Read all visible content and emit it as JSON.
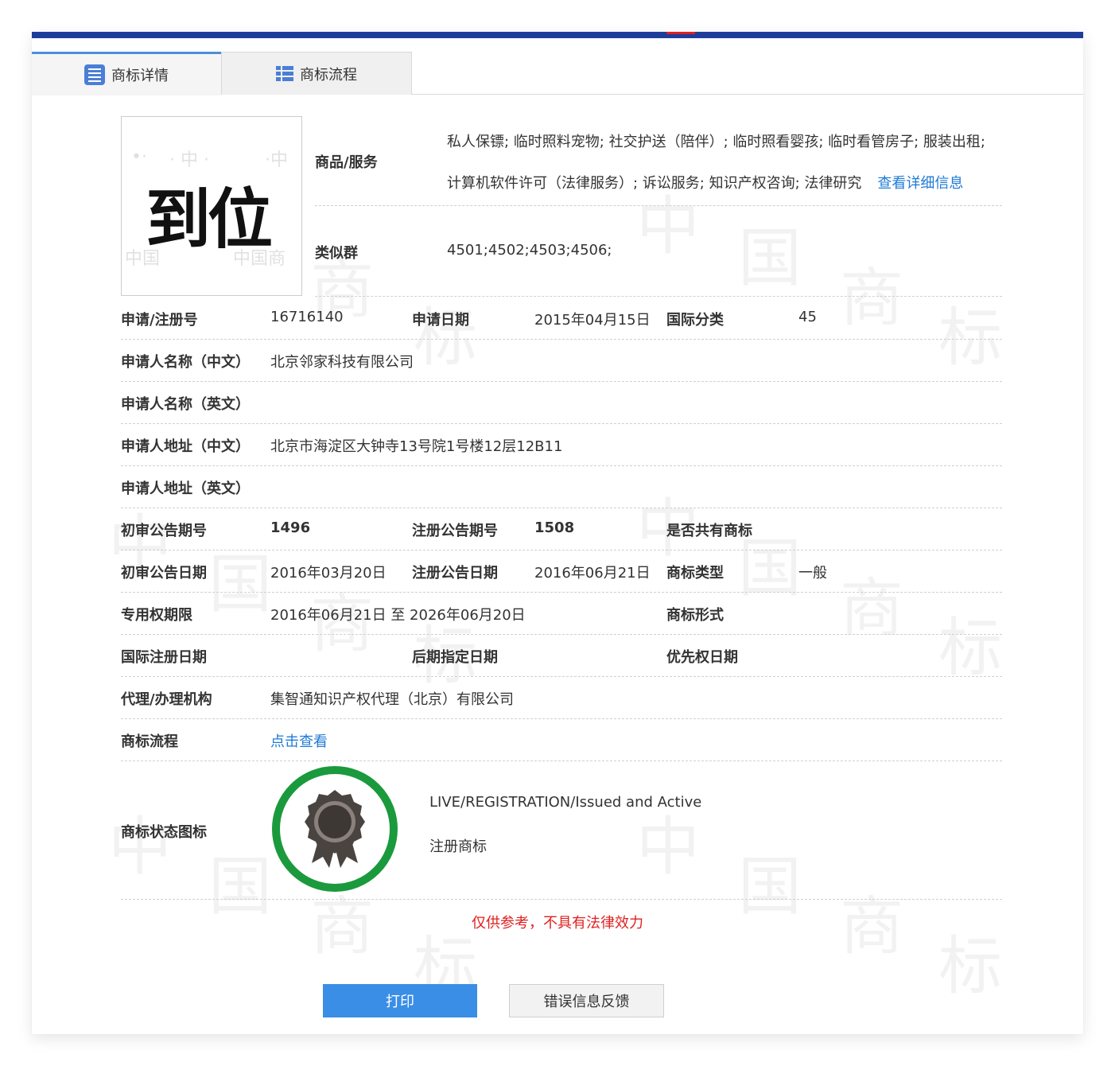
{
  "tabs": {
    "detail": "商标详情",
    "process": "商标流程"
  },
  "trademark": {
    "mark_text": "到位",
    "goods_label": "商品/服务",
    "goods_line1": "私人保镖; 临时照料宠物; 社交护送（陪伴）; 临时照看婴孩; 临时看管房子; 服装出租;",
    "goods_line2": "计算机软件许可（法律服务）; 诉讼服务; 知识产权咨询; 法律研究",
    "goods_more_link": "查看详细信息",
    "similar_label": "类似群",
    "similar_value": "4501;4502;4503;4506;"
  },
  "fields": {
    "reg_no_label": "申请/注册号",
    "reg_no": "16716140",
    "apply_date_label": "申请日期",
    "apply_date": "2015年04月15日",
    "intl_class_label": "国际分类",
    "intl_class": "45",
    "applicant_cn_label": "申请人名称（中文）",
    "applicant_cn": "北京邻家科技有限公司",
    "applicant_en_label": "申请人名称（英文）",
    "applicant_en": "",
    "address_cn_label": "申请人地址（中文）",
    "address_cn": "北京市海淀区大钟寺13号院1号楼12层12B11",
    "address_en_label": "申请人地址（英文）",
    "address_en": "",
    "prelim_no_label": "初审公告期号",
    "prelim_no": "1496",
    "reg_notice_no_label": "注册公告期号",
    "reg_notice_no": "1508",
    "shared_label": "是否共有商标",
    "shared": "",
    "prelim_date_label": "初审公告日期",
    "prelim_date": "2016年03月20日",
    "reg_notice_date_label": "注册公告日期",
    "reg_notice_date": "2016年06月21日",
    "type_label": "商标类型",
    "type": "一般",
    "term_label": "专用权期限",
    "term": "2016年06月21日 至 2026年06月20日",
    "form_label": "商标形式",
    "form": "",
    "intl_reg_date_label": "国际注册日期",
    "intl_reg_date": "",
    "later_date_label": "后期指定日期",
    "later_date": "",
    "priority_date_label": "优先权日期",
    "priority_date": "",
    "agent_label": "代理/办理机构",
    "agent": "集智通知识产权代理（北京）有限公司",
    "process_label": "商标流程",
    "process_link": "点击查看",
    "status_label": "商标状态图标",
    "status_en": "LIVE/REGISTRATION/Issued and Active",
    "status_cn": "注册商标"
  },
  "footer": {
    "disclaimer": "仅供参考，不具有法律效力",
    "print_button": "打印",
    "feedback_button": "错误信息反馈"
  },
  "colors": {
    "accent": "#3a8ee6",
    "link": "#1f7bd6",
    "warning": "#e02020",
    "badge_ring": "#1a9a3c",
    "prev_arrow": "#f5891f",
    "next_arrow": "#4a8fd6",
    "top_bar": "#1d3d9a"
  },
  "icons": {
    "detail_tab": "list-icon",
    "process_tab": "flow-list-icon",
    "prev": "arrow-left-icon",
    "next": "arrow-right-icon",
    "status": "award-ribbon-icon"
  }
}
